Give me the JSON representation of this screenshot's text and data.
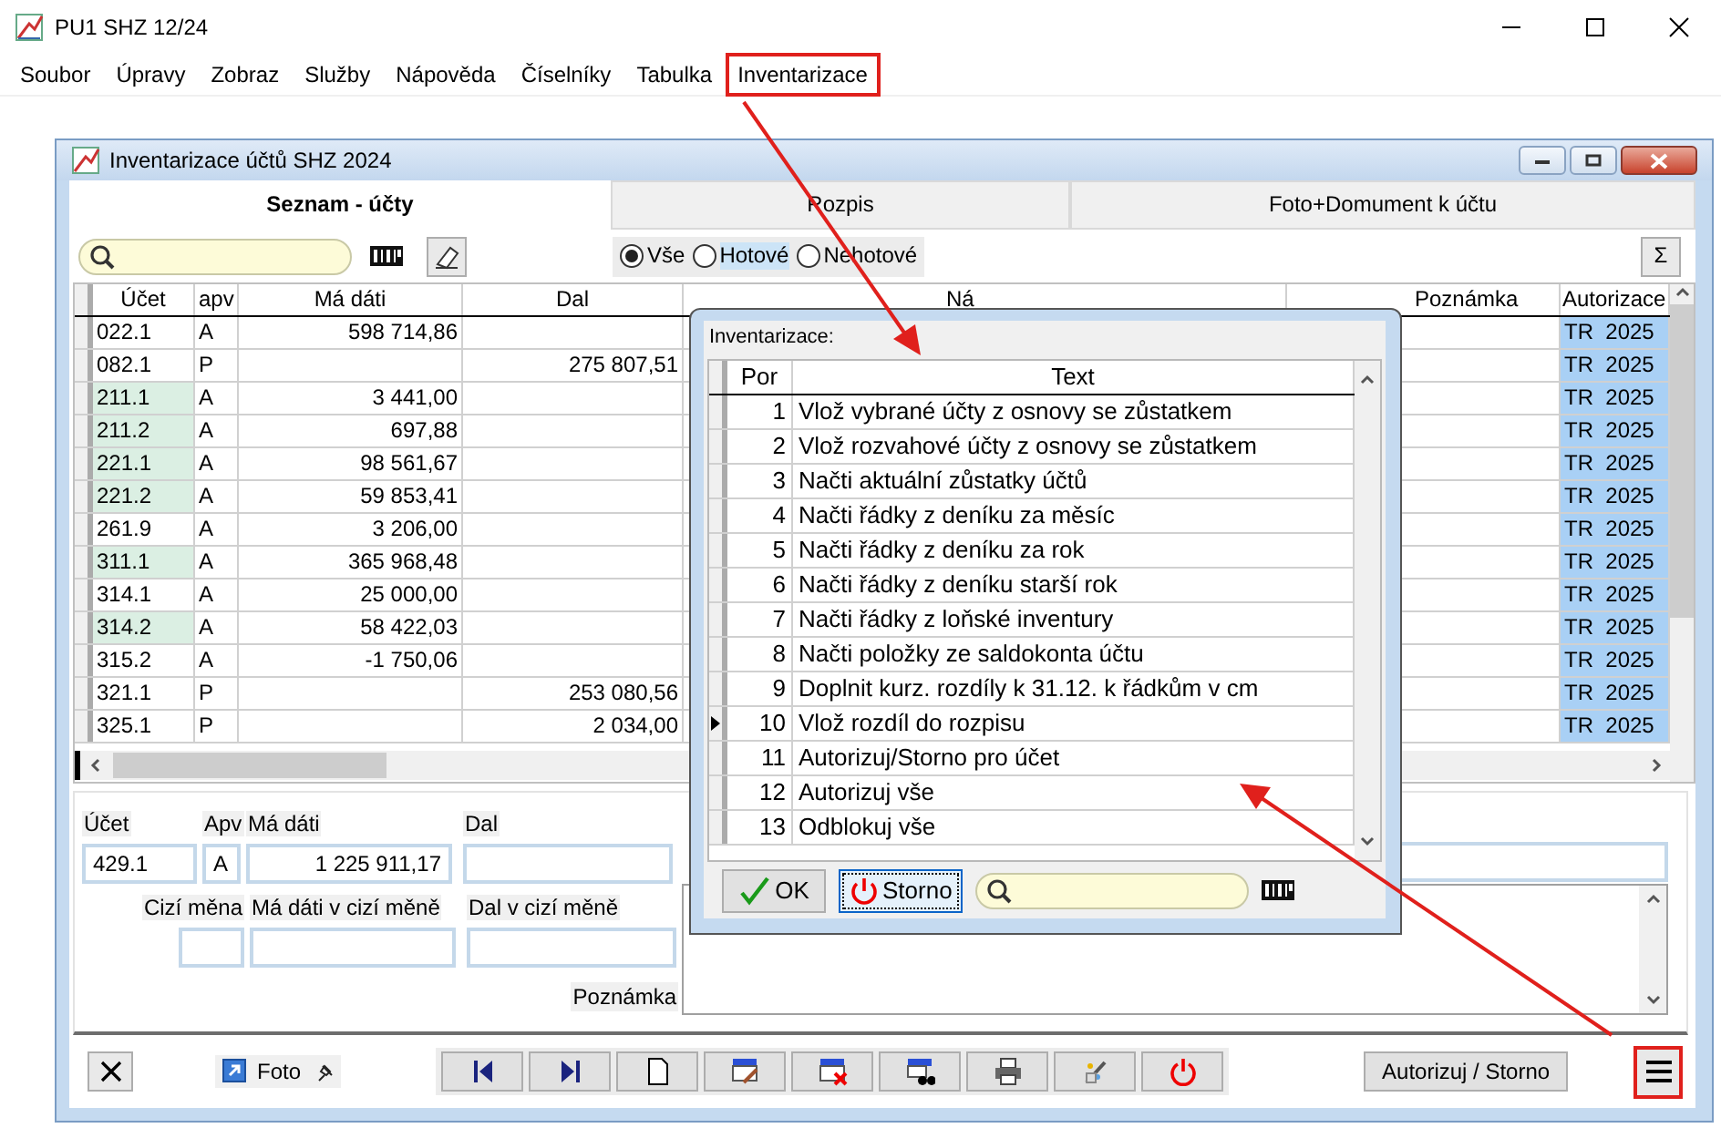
{
  "app": {
    "title": "PU1 SHZ 12/24"
  },
  "menu": [
    {
      "label": "Soubor",
      "highlighted": false
    },
    {
      "label": "Úpravy",
      "highlighted": false
    },
    {
      "label": "Zobraz",
      "highlighted": false
    },
    {
      "label": "Služby",
      "highlighted": false
    },
    {
      "label": "Nápověda",
      "highlighted": false
    },
    {
      "label": "Číselníky",
      "highlighted": false
    },
    {
      "label": "Tabulka",
      "highlighted": false
    },
    {
      "label": "Inventarizace",
      "highlighted": true
    }
  ],
  "window": {
    "title": "Inventarizace účtů SHZ 2024"
  },
  "tabs": [
    {
      "label": "Seznam - účty",
      "selected": true
    },
    {
      "label": "Rozpis",
      "selected": false
    },
    {
      "label": "Foto+Domument k účtu",
      "selected": false
    }
  ],
  "filter": {
    "options": [
      {
        "label": "Vše",
        "selected": true,
        "focused": false
      },
      {
        "label": "Hotové",
        "selected": false,
        "focused": true
      },
      {
        "label": "Nehotové",
        "selected": false,
        "focused": false
      }
    ],
    "sum_button": "Σ"
  },
  "table": {
    "columns": [
      "Účet",
      "apv",
      "Má dáti",
      "Dal",
      "Ná",
      "Poznámka",
      "Autorizace"
    ],
    "rows": [
      {
        "ucet": "022.1",
        "apv": "A",
        "ma_dati": "598 714,86",
        "autorizace": "TR  2025",
        "marked": false
      },
      {
        "ucet": "082.1",
        "apv": "P",
        "dal": "275 807,51",
        "autorizace": "TR  2025",
        "marked": false
      },
      {
        "ucet": "211.1",
        "apv": "A",
        "ma_dati": "3 441,00",
        "autorizace": "TR  2025",
        "marked": true
      },
      {
        "ucet": "211.2",
        "apv": "A",
        "ma_dati": "697,88",
        "autorizace": "TR  2025",
        "marked": true
      },
      {
        "ucet": "221.1",
        "apv": "A",
        "ma_dati": "98 561,67",
        "autorizace": "TR  2025",
        "marked": true
      },
      {
        "ucet": "221.2",
        "apv": "A",
        "ma_dati": "59 853,41",
        "autorizace": "TR  2025",
        "marked": true
      },
      {
        "ucet": "261.9",
        "apv": "A",
        "ma_dati": "3 206,00",
        "autorizace": "TR  2025",
        "marked": false
      },
      {
        "ucet": "311.1",
        "apv": "A",
        "ma_dati": "365 968,48",
        "autorizace": "TR  2025",
        "marked": true
      },
      {
        "ucet": "314.1",
        "apv": "A",
        "ma_dati": "25 000,00",
        "autorizace": "TR  2025",
        "marked": false
      },
      {
        "ucet": "314.2",
        "apv": "A",
        "ma_dati": "58 422,03",
        "autorizace": "TR  2025",
        "marked": true
      },
      {
        "ucet": "315.2",
        "apv": "A",
        "ma_dati": "-1 750,06",
        "autorizace": "TR  2025",
        "marked": false
      },
      {
        "ucet": "321.1",
        "apv": "P",
        "dal": "253 080,56",
        "autorizace": "TR  2025",
        "marked": false
      },
      {
        "ucet": "325.1",
        "apv": "P",
        "dal": "2 034,00",
        "autorizace": "TR  2025",
        "marked": false
      }
    ]
  },
  "detail": {
    "ucet_label": "Účet",
    "ucet": "429.1",
    "apv_label": "Apv",
    "apv": "A",
    "ma_dati_label": "Má dáti",
    "ma_dati": "1 225 911,17",
    "dal_label": "Dal",
    "cizi_mena_label": "Cizí měna",
    "ma_dati_cm_label": "Má dáti v cizí měně",
    "dal_cm_label": "Dal v cizí měně",
    "poznamka_label": "Poznámka"
  },
  "toolbar": {
    "foto_link": "Foto",
    "nav_buttons": [
      {
        "kind": "first"
      },
      {
        "kind": "last"
      },
      {
        "kind": "new"
      },
      {
        "kind": "edit"
      },
      {
        "kind": "delete"
      },
      {
        "kind": "find"
      },
      {
        "kind": "print"
      },
      {
        "kind": "tools"
      },
      {
        "kind": "power"
      }
    ],
    "authorize_button": "Autorizuj / Storno",
    "menu_button_highlighted": true
  },
  "dialog": {
    "title": "Inventarizace:",
    "columns": [
      "Por",
      "Text"
    ],
    "rows": [
      {
        "por": "1",
        "text": "Vlož vybrané účty z osnovy se zůstatkem",
        "current": false
      },
      {
        "por": "2",
        "text": "Vlož rozvahové účty z osnovy se zůstatkem",
        "current": false
      },
      {
        "por": "3",
        "text": "Načti aktuální zůstatky účtů",
        "current": false
      },
      {
        "por": "4",
        "text": "Načti řádky z deníku za měsíc",
        "current": false
      },
      {
        "por": "5",
        "text": "Načti řádky z deníku za rok",
        "current": false
      },
      {
        "por": "6",
        "text": "Načti řádky z deníku starší rok",
        "current": false
      },
      {
        "por": "7",
        "text": "Načti řádky z loňské inventury",
        "current": false
      },
      {
        "por": "8",
        "text": "Načti položky ze saldokonta účtu",
        "current": false
      },
      {
        "por": "9",
        "text": "Doplnit kurz. rozdíly k 31.12. k řádkům v cm",
        "current": false
      },
      {
        "por": "10",
        "text": "Vlož rozdíl do rozpisu",
        "current": true
      },
      {
        "por": "11",
        "text": "Autorizuj/Storno pro účet",
        "current": false
      },
      {
        "por": "12",
        "text": "Autorizuj vše",
        "current": false
      },
      {
        "por": "13",
        "text": "Odblokuj vše",
        "current": false
      }
    ],
    "ok": {
      "label": "OK",
      "focused": false
    },
    "cancel": {
      "label": "Storno",
      "focused": true
    }
  }
}
